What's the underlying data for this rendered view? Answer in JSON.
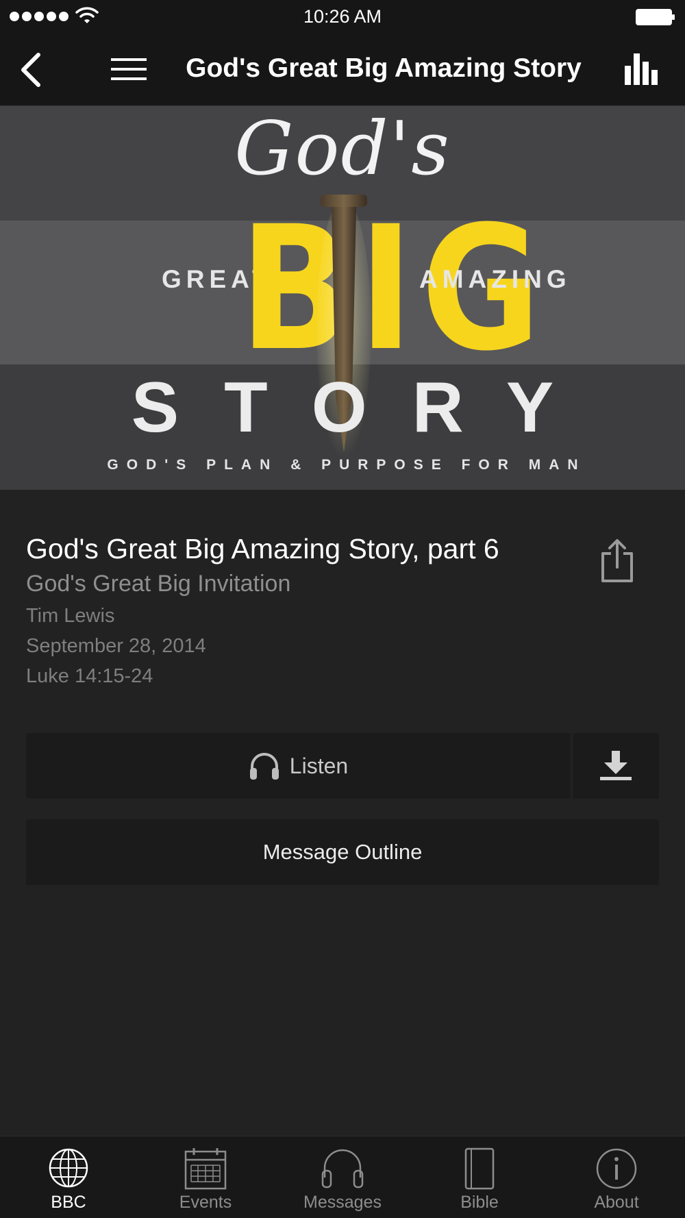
{
  "status_bar": {
    "time": "10:26 AM"
  },
  "nav": {
    "title": "God's Great Big Amazing Story",
    "back_icon": "chevron-left-icon",
    "menu_icon": "hamburger-menu-icon",
    "stats_icon": "bar-chart-icon"
  },
  "hero": {
    "gods": "God's",
    "great": "GREAT",
    "big": "BIG",
    "amazing": "AMAZING",
    "story": "STORY",
    "tagline": "GOD'S PLAN & PURPOSE FOR MAN"
  },
  "message": {
    "title": "God's Great Big Amazing Story, part 6",
    "subtitle": "God's Great Big Invitation",
    "speaker": "Tim Lewis",
    "date": "September 28, 2014",
    "scripture": "Luke 14:15-24"
  },
  "actions": {
    "listen_label": "Listen",
    "outline_label": "Message Outline"
  },
  "tabs": [
    {
      "label": "BBC",
      "icon": "globe-icon",
      "active": true
    },
    {
      "label": "Events",
      "icon": "calendar-icon",
      "active": false
    },
    {
      "label": "Messages",
      "icon": "headphones-icon",
      "active": false
    },
    {
      "label": "Bible",
      "icon": "book-icon",
      "active": false
    },
    {
      "label": "About",
      "icon": "info-icon",
      "active": false
    }
  ],
  "colors": {
    "background": "#222222",
    "bar": "#161616",
    "accent_yellow": "#f7d51d"
  }
}
